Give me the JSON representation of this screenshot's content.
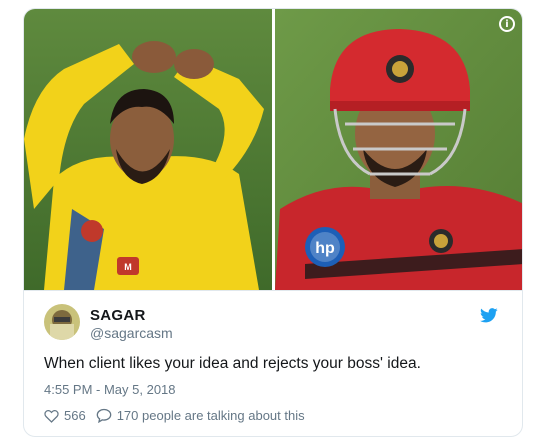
{
  "tweet": {
    "author_name": "SAGAR",
    "author_handle": "@sagarcasm",
    "text": "When client likes your idea and rejects your boss' idea.",
    "timestamp": "4:55 PM - May 5, 2018",
    "likes": "566",
    "replies_text": "170 people are talking about this"
  },
  "icons": {
    "info": "info-icon",
    "twitter": "twitter-bird-icon",
    "like": "heart-icon",
    "reply": "speech-bubble-icon"
  },
  "colors": {
    "twitter_blue": "#1da1f2",
    "secondary_text": "#657786",
    "border": "#e1e8ed"
  }
}
